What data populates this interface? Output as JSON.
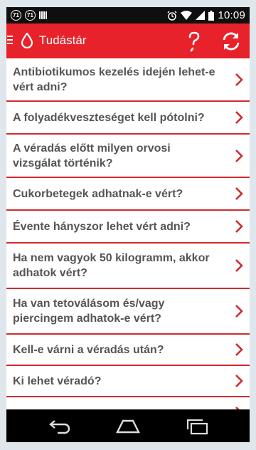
{
  "status_bar": {
    "notif_1": "71",
    "notif_2": "71",
    "time": "10:09"
  },
  "app_bar": {
    "title": "Tudástár",
    "icons": [
      "menu-icon",
      "blood-drop-icon",
      "help-icon",
      "refresh-icon"
    ]
  },
  "faq": {
    "items": [
      {
        "label": "Antibiotikumos kezelés idején lehet-e vért adni?"
      },
      {
        "label": "A folyadékveszteséget kell pótolni?"
      },
      {
        "label": "A véradás előtt milyen orvosi vizsgálat történik?"
      },
      {
        "label": "Cukorbetegek adhatnak-e vért?"
      },
      {
        "label": "Évente hányszor lehet vért adni?"
      },
      {
        "label": "Ha nem vagyok 50 kilogramm, akkor adhatok vért?"
      },
      {
        "label": "Ha van tetoválásom és/vagy piercingem adhatok-e vért?"
      },
      {
        "label": "Kell-e várni a véradás után?"
      },
      {
        "label": "Ki lehet véradó?"
      }
    ]
  },
  "nav_bar": {
    "icons": [
      "back-icon",
      "home-icon",
      "recents-icon"
    ]
  },
  "colors": {
    "accent": "#e8222b",
    "divider": "#d12a2f",
    "text": "#555555"
  }
}
